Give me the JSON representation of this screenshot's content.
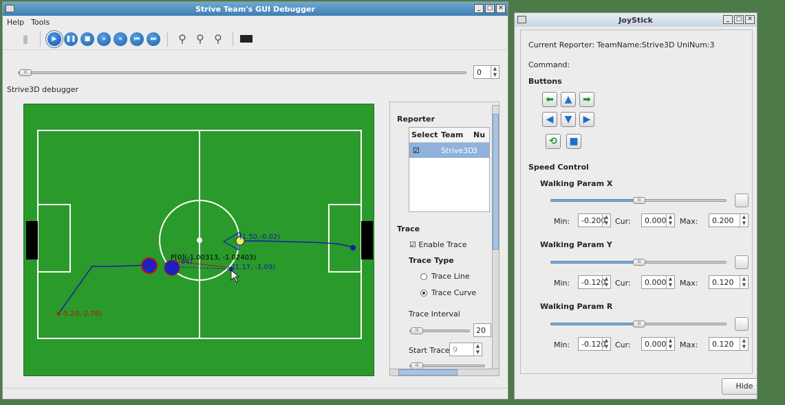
{
  "debugger": {
    "title": "Strive Team's GUI Debugger",
    "menu": [
      "Help",
      "Tools"
    ],
    "frame_value": "0",
    "caption": "Strive3D debugger",
    "field_labels": {
      "label_a": "(1.50,-0.02)",
      "label_b": "P[0](-1.00313, -1.02403)",
      "label_c": "(1.17, -1.09)",
      "label_d": "(-5.20,-2.78)",
      "label_e": "94)"
    },
    "reporter": {
      "heading": "Reporter",
      "columns": [
        "Select",
        "Team",
        "Nu"
      ],
      "rows": [
        {
          "select": "☑",
          "team": "Strive3D",
          "num": "3"
        }
      ]
    },
    "trace": {
      "heading": "Trace",
      "enable_label": "Enable Trace",
      "enable_checked": "☑",
      "type_heading": "Trace Type",
      "opt_line": "Trace Line",
      "opt_curve": "Trace Curve",
      "interval_label": "Trace Interval",
      "interval_value": "20",
      "start_label": "Start Trace",
      "start_value": "9"
    }
  },
  "joystick": {
    "title": "JoyStick",
    "reporter_line": "Current Reporter: TeamName:Strive3D  UniNum:3",
    "command_label": "Command:",
    "buttons_heading": "Buttons",
    "speed_heading": "Speed Control",
    "params": [
      {
        "name": "Walking Param X",
        "min": "-0.200",
        "cur": "0.000",
        "max": "0.200"
      },
      {
        "name": "Walking Param Y",
        "min": "-0.120",
        "cur": "0.000",
        "max": "0.120"
      },
      {
        "name": "Walking Param R",
        "min": "-0.120",
        "cur": "0.000",
        "max": "0.120"
      }
    ],
    "min_label": "Min:",
    "cur_label": "Cur:",
    "max_label": "Max:",
    "hide_label": "Hide"
  },
  "colors": {
    "field": "#2a9a2a",
    "trace_blue": "#1a1ab0",
    "titlebar": "#3d7fb4"
  }
}
